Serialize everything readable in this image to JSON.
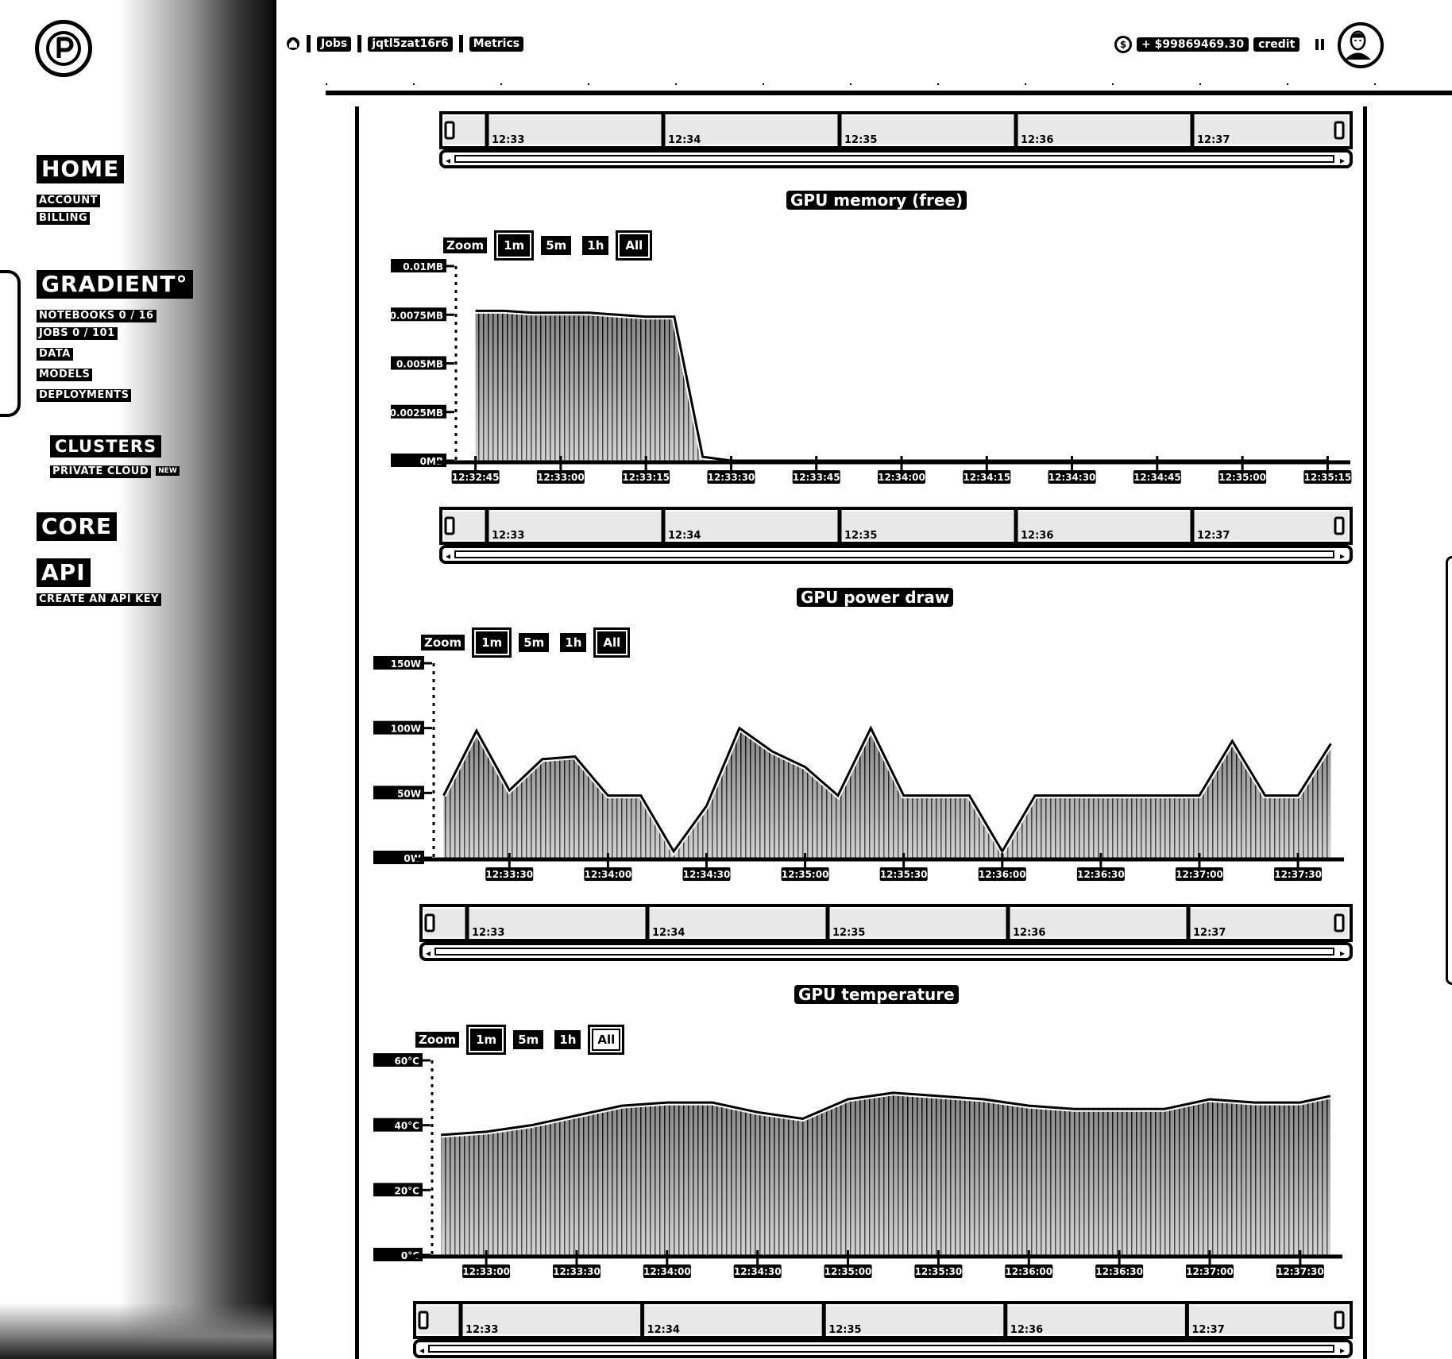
{
  "sidebar": {
    "sections": [
      {
        "title": "HOME",
        "items": [
          "ACCOUNT",
          "BILLING"
        ]
      },
      {
        "title": "GRADIENT°",
        "items": [
          "NOTEBOOKS 0 / 16",
          "JOBS 0 / 101",
          "DATA",
          "MODELS",
          "DEPLOYMENTS"
        ]
      },
      {
        "title": "CLUSTERS",
        "items": [
          "PRIVATE CLOUD"
        ]
      },
      {
        "title": "CORE",
        "items": []
      },
      {
        "title": "API",
        "items": [
          "CREATE AN API KEY"
        ]
      }
    ],
    "active_item": "JOBS 0 / 101",
    "new_badge": "NEW"
  },
  "header": {
    "breadcrumb": [
      "Jobs",
      "jqtl5zat16r6",
      "Metrics"
    ],
    "credit_amount": "+ $99869469.30",
    "credit_label": "credit"
  },
  "charts": [
    {
      "title": "GPU memory (free)",
      "zoom_label": "Zoom",
      "zoom_options": [
        "1m",
        "5m",
        "1h",
        "All"
      ],
      "y_ticks": [
        "0.01MB",
        "0.0075MB",
        "0.005MB",
        "0.0025MB",
        "0MB"
      ],
      "x_ticks": [
        "12:32:45",
        "12:33:00",
        "12:33:15",
        "12:33:30",
        "12:33:45",
        "12:34:00",
        "12:34:15",
        "12:34:30",
        "12:34:45",
        "12:35:00",
        "12:35:15"
      ],
      "navigator_ticks": [
        "12:33",
        "12:34",
        "12:35",
        "12:36",
        "12:37"
      ]
    },
    {
      "title": "GPU power draw",
      "zoom_label": "Zoom",
      "zoom_options": [
        "1m",
        "5m",
        "1h",
        "All"
      ],
      "y_ticks": [
        "150W",
        "100W",
        "50W",
        "0W"
      ],
      "x_ticks": [
        "12:33:30",
        "12:34:00",
        "12:34:30",
        "12:35:00",
        "12:35:30",
        "12:36:00",
        "12:36:30",
        "12:37:00",
        "12:37:30"
      ],
      "navigator_ticks": [
        "12:33",
        "12:34",
        "12:35",
        "12:36",
        "12:37"
      ]
    },
    {
      "title": "GPU temperature",
      "zoom_label": "Zoom",
      "zoom_options": [
        "1m",
        "5m",
        "1h",
        "All"
      ],
      "y_ticks": [
        "60°C",
        "40°C",
        "20°C",
        "0°C"
      ],
      "x_ticks": [
        "12:33:00",
        "12:33:30",
        "12:34:00",
        "12:34:30",
        "12:35:00",
        "12:35:30",
        "12:36:00",
        "12:36:30",
        "12:37:00",
        "12:37:30"
      ],
      "navigator_ticks": [
        "12:33",
        "12:34",
        "12:35",
        "12:36",
        "12:37"
      ]
    }
  ],
  "chart_data": [
    {
      "type": "area",
      "title": "GPU memory (free)",
      "ylim": [
        0,
        0.01
      ],
      "y_unit": "MB",
      "x": [
        "12:32:45",
        "12:32:50",
        "12:32:55",
        "12:33:00",
        "12:33:05",
        "12:33:10",
        "12:33:15",
        "12:33:20",
        "12:33:25",
        "12:33:30",
        "12:33:45",
        "12:34:00",
        "12:34:15",
        "12:34:30",
        "12:34:45",
        "12:35:00",
        "12:35:15"
      ],
      "values": [
        0.0077,
        0.0077,
        0.0076,
        0.0076,
        0.0076,
        0.0075,
        0.0074,
        0.0074,
        0.0002,
        0,
        0,
        0,
        0,
        0,
        0,
        0,
        0
      ]
    },
    {
      "type": "area",
      "title": "GPU power draw",
      "ylim": [
        0,
        150
      ],
      "y_unit": "W",
      "x": [
        "12:33:10",
        "12:33:20",
        "12:33:30",
        "12:33:40",
        "12:33:50",
        "12:34:00",
        "12:34:10",
        "12:34:20",
        "12:34:30",
        "12:34:40",
        "12:34:50",
        "12:35:00",
        "12:35:10",
        "12:35:20",
        "12:35:30",
        "12:35:40",
        "12:35:50",
        "12:36:00",
        "12:36:10",
        "12:36:20",
        "12:36:30",
        "12:36:40",
        "12:36:50",
        "12:37:00",
        "12:37:10",
        "12:37:20",
        "12:37:30",
        "12:37:40"
      ],
      "values": [
        48,
        98,
        52,
        76,
        78,
        48,
        48,
        5,
        40,
        100,
        82,
        70,
        48,
        100,
        48,
        48,
        48,
        5,
        48,
        48,
        48,
        48,
        48,
        48,
        90,
        48,
        48,
        88
      ]
    },
    {
      "type": "area",
      "title": "GPU temperature",
      "ylim": [
        0,
        60
      ],
      "y_unit": "°C",
      "x": [
        "12:32:45",
        "12:33:00",
        "12:33:15",
        "12:33:30",
        "12:33:45",
        "12:34:00",
        "12:34:15",
        "12:34:30",
        "12:34:45",
        "12:35:00",
        "12:35:15",
        "12:35:30",
        "12:35:45",
        "12:36:00",
        "12:36:15",
        "12:36:30",
        "12:36:45",
        "12:37:00",
        "12:37:15",
        "12:37:30",
        "12:37:40"
      ],
      "values": [
        37,
        38,
        40,
        43,
        46,
        47,
        47,
        44,
        42,
        48,
        50,
        49,
        48,
        46,
        45,
        45,
        45,
        48,
        47,
        47,
        49
      ]
    }
  ]
}
